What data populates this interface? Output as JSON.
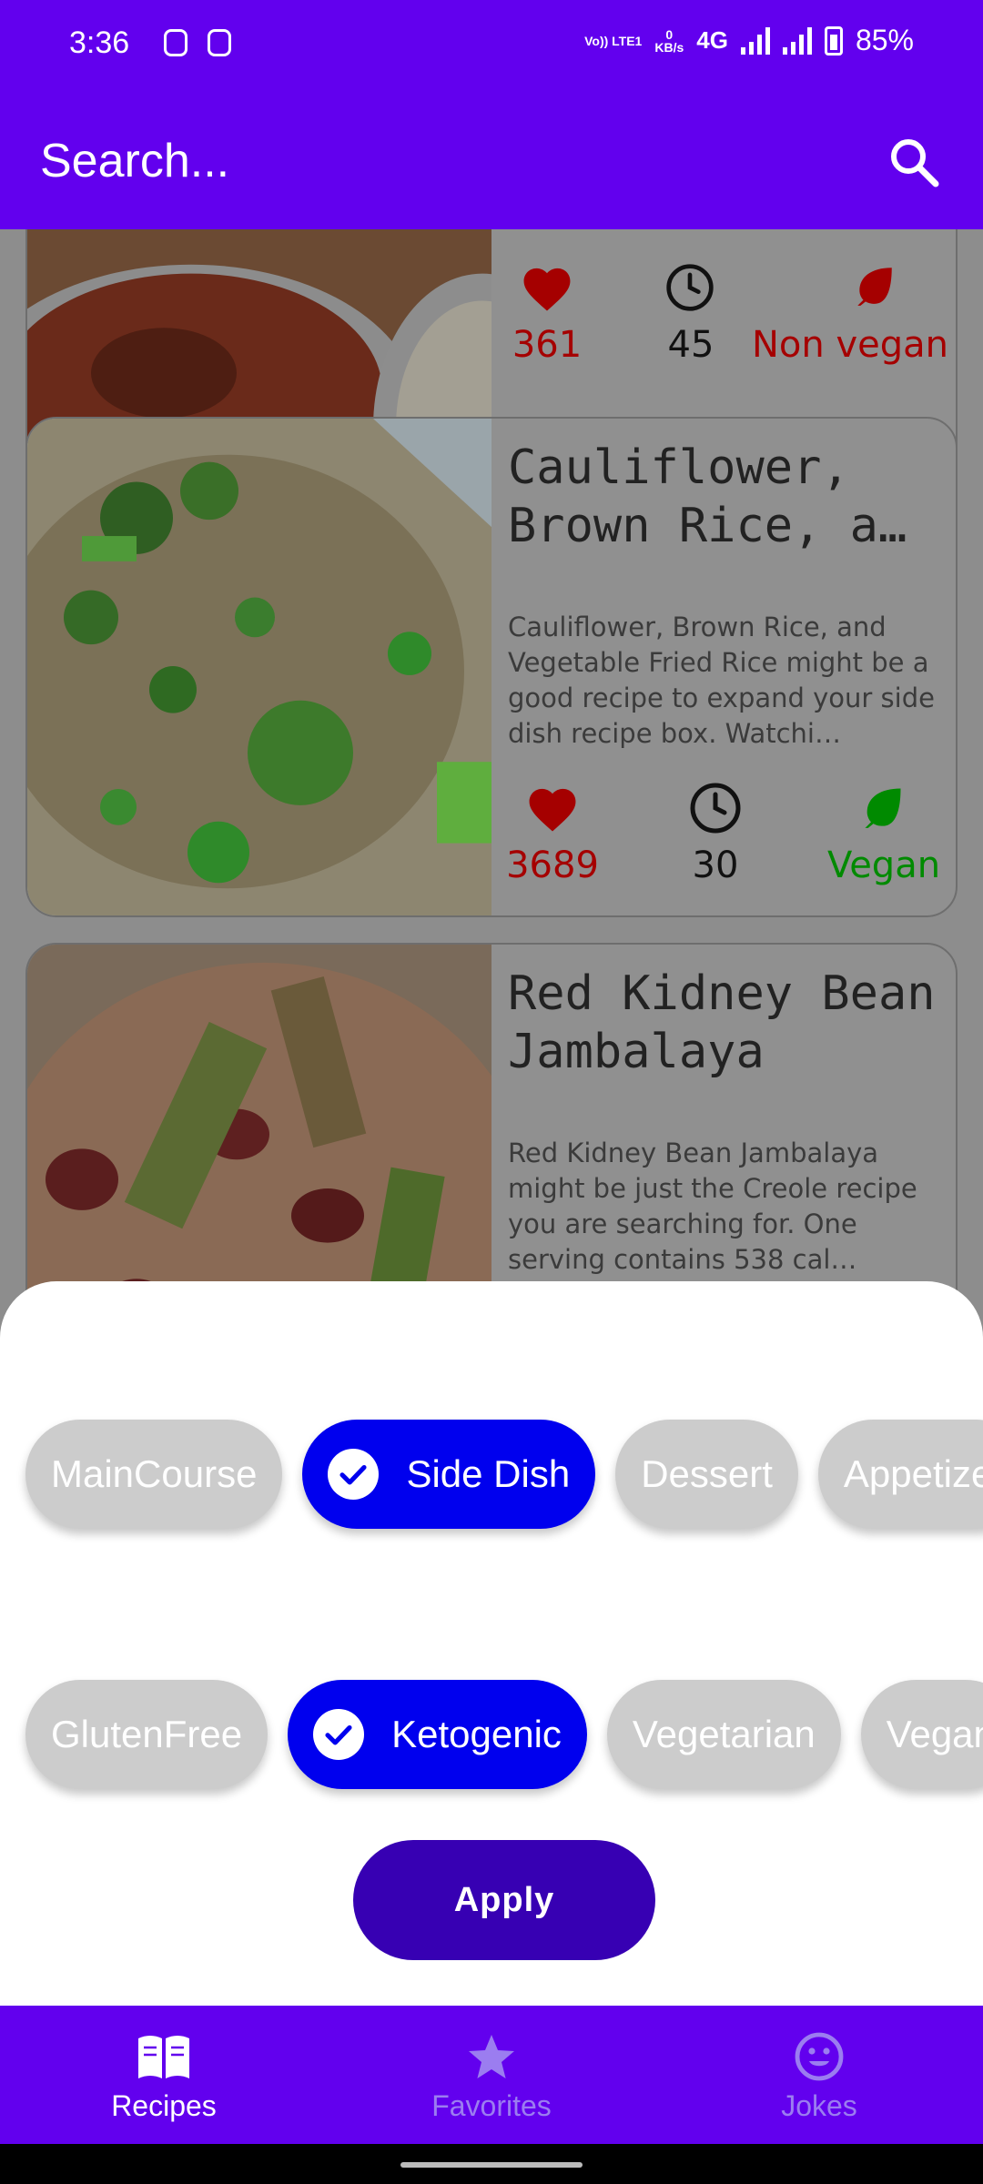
{
  "status_bar": {
    "time": "3:36",
    "volte_label": "Vo)) LTE1",
    "speed_value": "0",
    "speed_unit": "KB/s",
    "network": "4G",
    "battery_percent": "85%"
  },
  "app_bar": {
    "search_placeholder": "Search..."
  },
  "recipes": [
    {
      "title": "",
      "description": "",
      "likes": "361",
      "minutes": "45",
      "diet": "Non vegan",
      "diet_color": "#a50000"
    },
    {
      "title": "Cauliflower, Brown Rice, a…",
      "description": "Cauliflower, Brown Rice, and Vegetable Fried Rice might be a good recipe to expand your side dish recipe box. Watchi…",
      "likes": "3689",
      "minutes": "30",
      "diet": "Vegan",
      "diet_color": "#008a00"
    },
    {
      "title": "Red Kidney Bean Jambalaya",
      "description": "Red Kidney Bean Jambalaya might be just the Creole recipe you are searching for. One serving contains 538 cal…"
    }
  ],
  "filter_sheet": {
    "meal_types": [
      {
        "label": "MainCourse",
        "selected": false
      },
      {
        "label": "Side Dish",
        "selected": true
      },
      {
        "label": "Dessert",
        "selected": false
      },
      {
        "label": "Appetizer",
        "selected": false
      }
    ],
    "diet_types": [
      {
        "label": "GlutenFree",
        "selected": false
      },
      {
        "label": "Ketogenic",
        "selected": true
      },
      {
        "label": "Vegetarian",
        "selected": false
      },
      {
        "label": "Vegan",
        "selected": false
      }
    ],
    "apply_label": "Apply"
  },
  "bottom_nav": [
    {
      "label": "Recipes",
      "icon": "book-icon",
      "active": true
    },
    {
      "label": "Favorites",
      "icon": "star-icon",
      "active": false
    },
    {
      "label": "Jokes",
      "icon": "smiley-icon",
      "active": false
    }
  ],
  "colors": {
    "primary": "#6200ee",
    "primary_dark": "#3700b3",
    "chip_selected": "#0000ee",
    "chip_unselected": "#cccccc",
    "like_red": "#a50000",
    "vegan_green": "#008a00"
  }
}
